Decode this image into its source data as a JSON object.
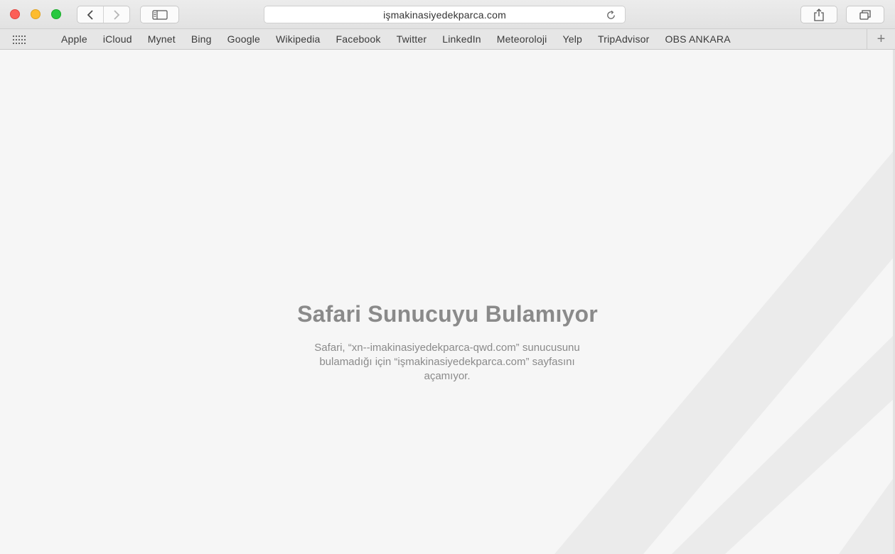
{
  "window": {
    "address": "işmakinasiyedekparca.com"
  },
  "bookmarks": [
    {
      "label": "Apple"
    },
    {
      "label": "iCloud"
    },
    {
      "label": "Mynet"
    },
    {
      "label": "Bing"
    },
    {
      "label": "Google"
    },
    {
      "label": "Wikipedia"
    },
    {
      "label": "Facebook"
    },
    {
      "label": "Twitter"
    },
    {
      "label": "LinkedIn"
    },
    {
      "label": "Meteoroloji"
    },
    {
      "label": "Yelp"
    },
    {
      "label": "TripAdvisor"
    },
    {
      "label": "OBS ANKARA"
    }
  ],
  "bookmarks_add": "+",
  "error": {
    "title": "Safari Sunucuyu Bulamıyor",
    "message_line1": "Safari, “xn--imakinasiyedekparca-qwd.com” sunucusunu",
    "message_line2": "bulamadığı için “işmakinasiyedekparca.com” sayfasını",
    "message_line3": "açamıyor."
  },
  "icons": {
    "close": "close-icon",
    "minimize": "minimize-icon",
    "zoom": "zoom-icon",
    "back": "back-icon",
    "forward": "forward-icon",
    "sidebar": "sidebar-icon",
    "reload": "reload-icon",
    "share": "share-icon",
    "tabs": "tabs-icon",
    "grid": "grid-icon"
  },
  "colors": {
    "close": "#fc5f57",
    "minimize": "#fdbc2e",
    "zoom": "#28c840",
    "page_background": "#f6f6f6",
    "error_text": "#8a8a8a"
  }
}
